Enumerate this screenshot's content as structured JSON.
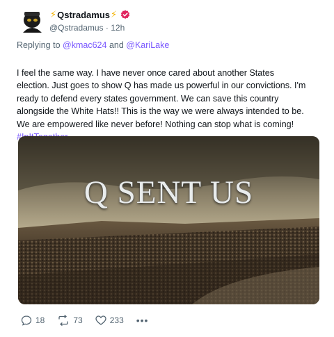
{
  "author": {
    "display_name": "Qstradamus",
    "handle": "@Qstradamus",
    "time_ago": "12h",
    "badge_icon": "verified-badge-icon",
    "badge_color": "#e0245e",
    "emoji_icon": "lightning-bolt-icon",
    "emoji_glyph": "⚡",
    "separator": "·"
  },
  "reply": {
    "prefix": "Replying to",
    "mention_1": "@kmac624",
    "conjunction": "and",
    "mention_2": "@KariLake"
  },
  "post": {
    "text": "I feel the same way. I have never once cared about another States\nelection. Just goes to show Q has made us powerful in our convictions. I'm\nready to defend every states government. We can save this country\nalongside the White Hats!! This is the way we were always intended to be.\nWe are empowered like never before! Nothing can stop what is coming!",
    "hashtag": "#InItTogether",
    "link_color": "#7856ff"
  },
  "media": {
    "overlay_text": "Q SENT US"
  },
  "actions": {
    "replies": "18",
    "reposts": "73",
    "likes": "233",
    "reply_icon": "reply-icon",
    "repost_icon": "repost-icon",
    "like_icon": "heart-icon",
    "more_label": "•••"
  }
}
